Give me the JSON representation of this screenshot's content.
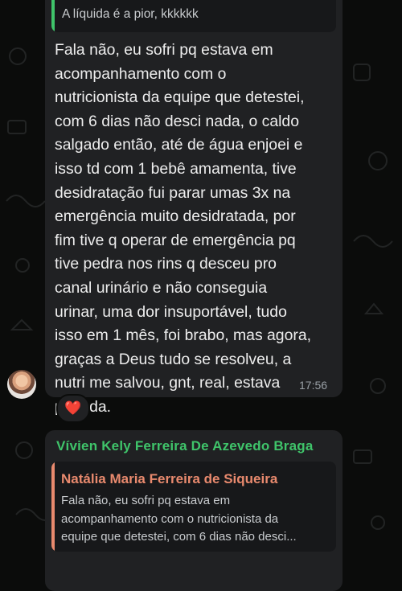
{
  "top_message": {
    "quoted_text": "A líquida é a pior, kkkkkk",
    "body": "Fala não, eu sofri pq estava em\nacompanhamento com o\nnutricionista da equipe que detestei,\ncom 6 dias não desci nada, o caldo\nsalgado então, até de água enjoei e\nisso td com 1 bebê amamenta, tive\ndesidratação fui parar umas 3x na\nemergência muito desidratada, por\nfim tive q operar de emergência pq\ntive pedra nos rins q desceu pro\ncanal urinário e não conseguia\nurinar, uma dor insuportável, tudo\nisso em 1 mês, foi brabo, mas agora,\ngraças a Deus tudo se resolveu, a\nnutri me salvou, gnt, real, estava\nperdida.",
    "time": "17:56",
    "reaction": "❤️"
  },
  "reply_message": {
    "sender": "Vívien Kely Ferreira De Azevedo Braga",
    "quoted_author": "Natália Maria Ferreira de Siqueira",
    "quoted_text": "Fala não, eu sofri pq estava em\nacompanhamento com o nutricionista da\nequipe que detestei, com 6 dias não desci..."
  },
  "colors": {
    "background": "#0b0c0b",
    "bubble": "#202123",
    "quote_bg": "#17181a",
    "sender_green": "#3fc46a",
    "quote_salmon": "#e98a6e",
    "quote_bar_top": "#3fc46a"
  },
  "icons": {
    "avatar": "avatar-photo",
    "reaction": "heart-icon"
  }
}
